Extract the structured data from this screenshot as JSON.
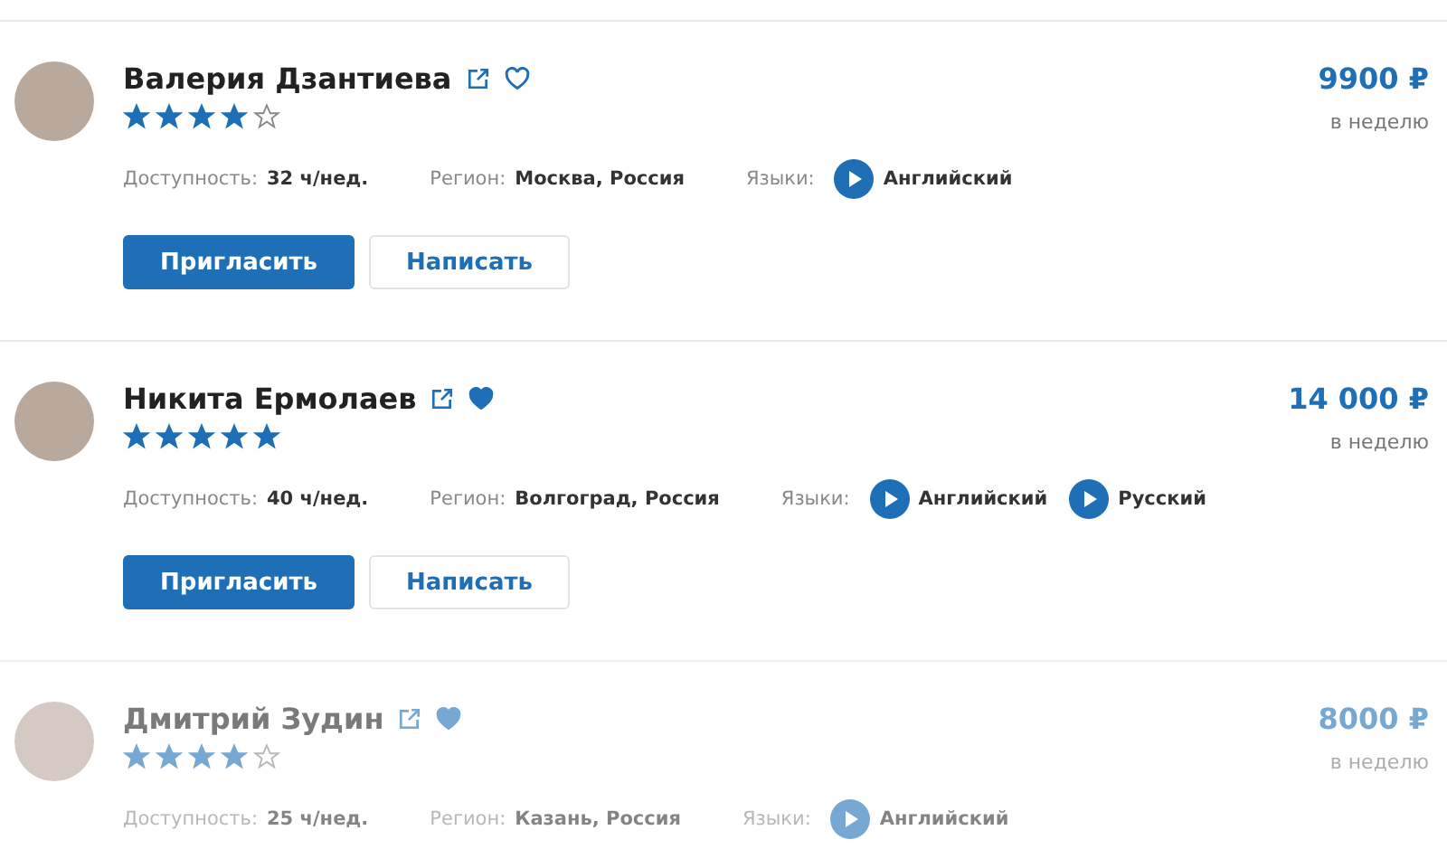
{
  "cards": [
    {
      "name": "Валерия Дзантиева",
      "favorite": false,
      "stars": 4,
      "price": "9900 ₽",
      "period": "в неделю",
      "faded": false,
      "availability_label": "Доступность:",
      "availability": "32 ч/нед.",
      "region_label": "Регион:",
      "region": "Москва, Россия",
      "languages_label": "Языки:",
      "languages": [
        "Английский"
      ],
      "buttons": [
        "Пригласить",
        "Написать"
      ]
    },
    {
      "name": "Никита Ермолаев",
      "favorite": true,
      "stars": 5,
      "price": "14 000 ₽",
      "period": "в неделю",
      "faded": false,
      "availability_label": "Доступность:",
      "availability": "40 ч/нед.",
      "region_label": "Регион:",
      "region": "Волгоград, Россия",
      "languages_label": "Языки:",
      "languages": [
        "Английский",
        "Русский"
      ],
      "buttons": [
        "Пригласить",
        "Написать"
      ]
    },
    {
      "name": "Дмитрий Зудин",
      "favorite": true,
      "stars": 4,
      "price": "8000 ₽",
      "period": "в неделю",
      "faded": true,
      "availability_label": "Доступность:",
      "availability": "25 ч/нед.",
      "region_label": "Регион:",
      "region": "Казань, Россия",
      "languages_label": "Языки:",
      "languages": [
        "Английский"
      ]
    }
  ]
}
